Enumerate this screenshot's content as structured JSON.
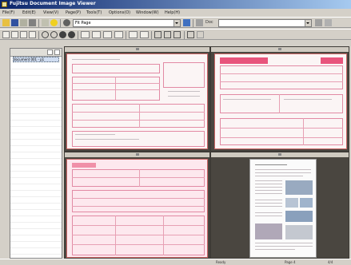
{
  "window": {
    "title": "Fujitsu Document Image Viewer"
  },
  "menu": [
    "File(F)",
    "Edit(E)",
    "View(V)",
    "Page(P)",
    "Tools(T)",
    "Options(O)",
    "Window(W)",
    "Help(H)"
  ],
  "toolbar": {
    "zoom_value": "Fit Page",
    "doc_field_label": "Doc",
    "doc_field_value": ""
  },
  "left_panel": {
    "items": [
      "document 001 - p1"
    ]
  },
  "status": {
    "left": "",
    "center": "Ready",
    "page": "Page 4",
    "zoom": "4/4"
  },
  "colors": {
    "form_red": "#e8547c",
    "form_line": "#e7a0b4"
  }
}
